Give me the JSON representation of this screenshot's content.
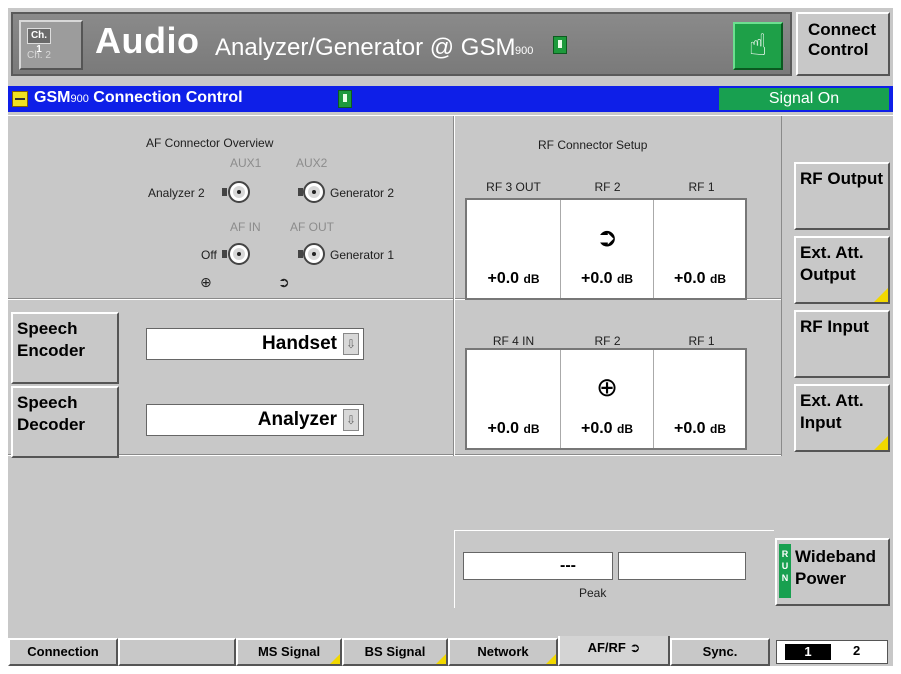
{
  "header": {
    "ch1": "Ch. 1",
    "ch2": "Ch. 2",
    "title_main": "Audio",
    "title_sub": "Analyzer/Generator @ GSM",
    "title_band": "900",
    "connect_control": "Connect Control"
  },
  "bluebar": {
    "title_prefix": "GSM",
    "title_band": "900",
    "title": "Connection Control",
    "signal_status": "Signal On",
    "signal_color": "#18a050"
  },
  "af_overview": {
    "heading": "AF Connector Overview",
    "aux1": "AUX1",
    "aux2": "AUX2",
    "analyzer2": "Analyzer 2",
    "generator2": "Generator 2",
    "af_in": "AF IN",
    "af_out": "AF OUT",
    "off": "Off",
    "generator1": "Generator 1"
  },
  "rf_setup": {
    "heading": "RF Connector Setup",
    "output_headers": [
      "RF 3 OUT",
      "RF 2",
      "RF 1"
    ],
    "output_values": [
      "+0.0",
      "+0.0",
      "+0.0"
    ],
    "input_headers": [
      "RF 4 IN",
      "RF 2",
      "RF 1"
    ],
    "input_values": [
      "+0.0",
      "+0.0",
      "+0.0"
    ],
    "unit": "dB"
  },
  "side_buttons": {
    "rf_output": "RF Output",
    "ext_att_output": "Ext. Att. Output",
    "rf_input": "RF Input",
    "ext_att_input": "Ext. Att. Input"
  },
  "speech": {
    "encoder_label": "Speech Encoder",
    "encoder_value": "Handset",
    "decoder_label": "Speech Decoder",
    "decoder_value": "Analyzer"
  },
  "wideband": {
    "peak_value": "---",
    "peak_label": "Peak",
    "run_letters": "RUN",
    "button": "Wideband Power"
  },
  "tabs": {
    "connection": "Connection",
    "empty": "",
    "ms_signal": "MS Signal",
    "bs_signal": "BS Signal",
    "network": "Network",
    "af_rf": "AF/RF",
    "sync": "Sync.",
    "page1": "1",
    "page2": "2"
  },
  "colors": {
    "accent_blue": "#0e1fe8",
    "status_green": "#18a050",
    "softkey_corner": "#f2d800"
  }
}
